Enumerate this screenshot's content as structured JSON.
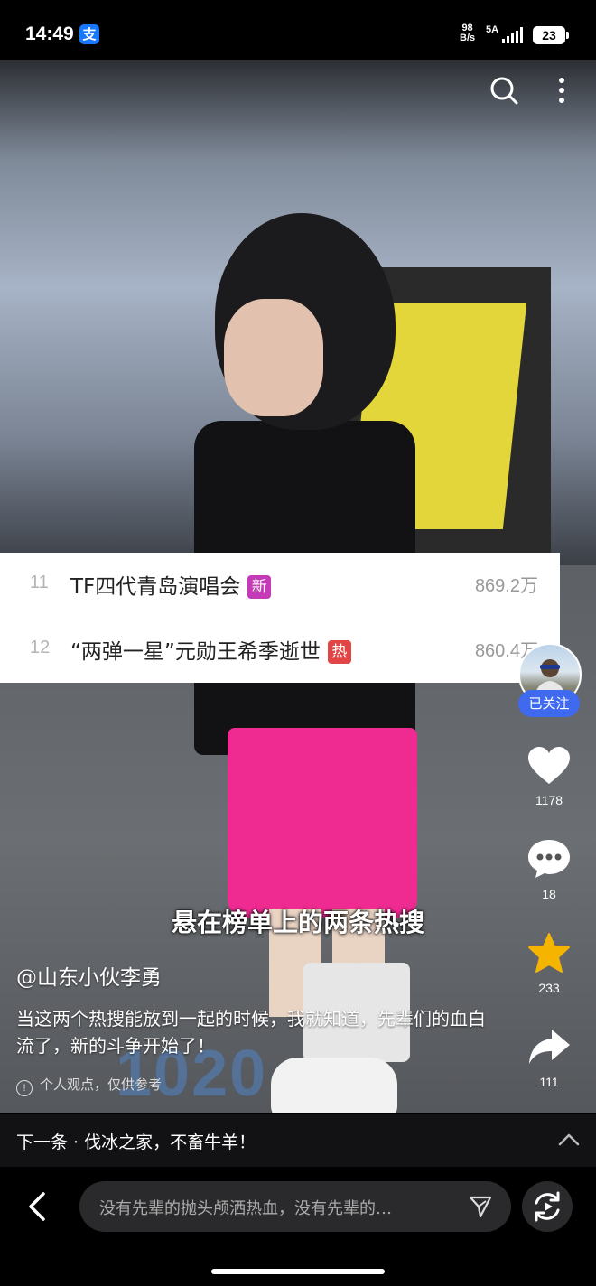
{
  "status_bar": {
    "time": "14:49",
    "alipay_icon_text": "支",
    "net_speed_value": "98",
    "net_speed_unit": "B/s",
    "signal_label": "5A",
    "battery": "23"
  },
  "hot_list": [
    {
      "rank": "11",
      "title": "TF四代青岛演唱会",
      "tag": "新",
      "tag_color": "#c53ab7",
      "count": "869.2万"
    },
    {
      "rank": "12",
      "title": "“两弹一星”元勋王希季逝世",
      "tag": "热",
      "tag_color": "#e24545",
      "count": "860.4万"
    }
  ],
  "rail": {
    "follow_label": "已关注",
    "like_count": "1178",
    "comment_count": "18",
    "favorite_count": "233",
    "share_count": "111"
  },
  "caption": {
    "subtitle": "悬在榜单上的两条热搜",
    "author": "@山东小伙李勇",
    "description": "当这两个热搜能放到一起的时候，我就知道，先辈们的血白流了，新的斗争开始了！",
    "disclaimer": "个人观点，仅供参考",
    "info_icon_text": "!",
    "watermark": "1020"
  },
  "next_bar": {
    "text": "下一条 · 伐冰之家，不畜牛羊！"
  },
  "bottom_bar": {
    "comment_placeholder": "没有先辈的抛头颅洒热血，没有先辈的…"
  }
}
